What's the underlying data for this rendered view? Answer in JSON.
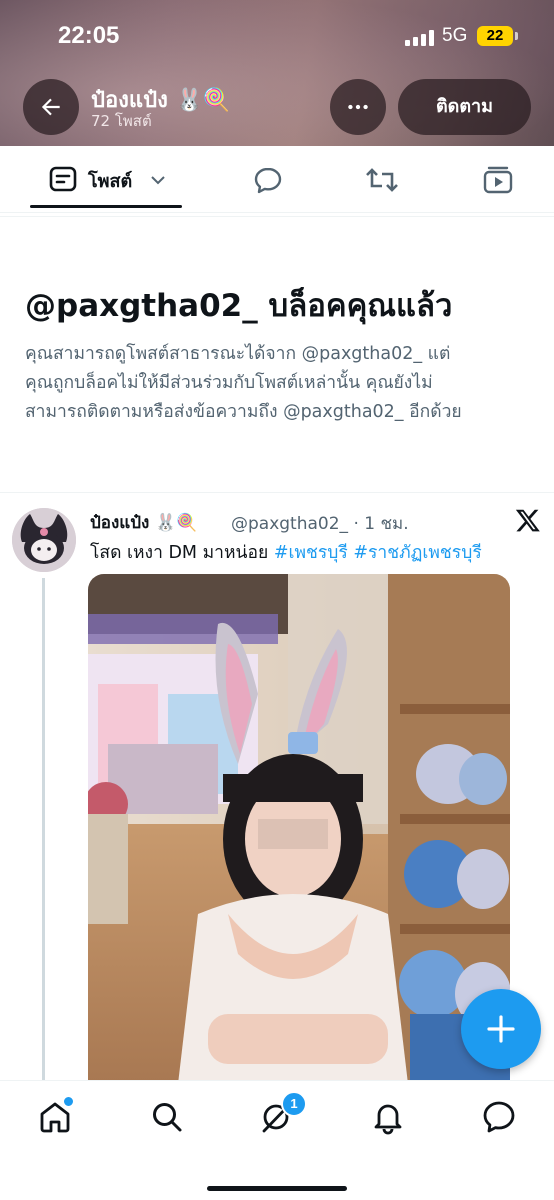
{
  "status": {
    "time": "22:05",
    "network": "5G",
    "battery": "22"
  },
  "profile": {
    "name": "ป๋องแป๋ง 🐰🍭",
    "posts": "72 โพสต์"
  },
  "header": {
    "follow_label": "ติดตาม"
  },
  "tabs": {
    "posts_label": "โพสต์"
  },
  "blocked": {
    "title": "@paxgtha02_ บล็อคคุณแล้ว",
    "line1": "คุณสามารถดูโพสต์สาธารณะได้จาก @paxgtha02_ แต่",
    "line2": "คุณถูกบล็อคไม่ให้มีส่วนร่วมกับโพสต์เหล่านั้น คุณยังไม่",
    "line3": "สามารถติดตามหรือส่งข้อความถึง @paxgtha02_ อีกด้วย"
  },
  "post": {
    "author": "ป๋องแป๋ง 🐰🍭",
    "handle_time": "@paxgtha02_ · 1 ชม.",
    "text": "โสด เหงา DM มาหน่อย",
    "hashtag1": "#เพชรบุรี",
    "hashtag2": "#ราชภัฏเพชรบุรี"
  },
  "nav": {
    "messages_badge": "1"
  },
  "colors": {
    "accent": "#1d9bf0",
    "text": "#0f1419",
    "muted": "#536471"
  },
  "icons": [
    "back-arrow-icon",
    "more-dots-icon",
    "posts-tab-icon",
    "chevron-down-icon",
    "reply-icon",
    "repost-icon",
    "media-icon",
    "x-logo-icon",
    "plus-icon",
    "home-icon",
    "search-icon",
    "grok-icon",
    "bell-icon",
    "messages-icon"
  ]
}
